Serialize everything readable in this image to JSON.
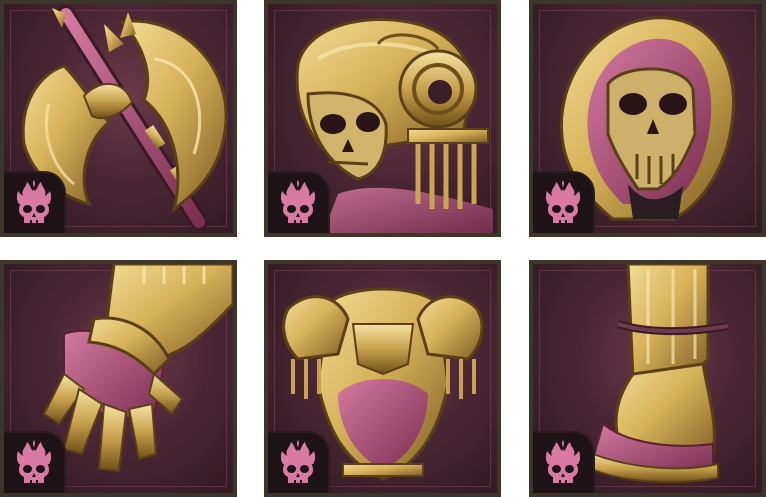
{
  "inventory": {
    "slots": [
      {
        "item": "axe-icon"
      },
      {
        "item": "ram-skull-helm-icon"
      },
      {
        "item": "skull-mask-icon"
      },
      {
        "item": "gauntlet-icon"
      },
      {
        "item": "chest-armor-icon"
      },
      {
        "item": "boot-icon"
      }
    ],
    "badge_icon": "flaming-skull-icon"
  },
  "colors": {
    "gold": "#d7b25a",
    "gold_dark": "#8a6a2a",
    "gold_light": "#f2dc95",
    "magenta": "#b8567e",
    "frame": "#3b352a",
    "tile_bg": "#4a2634",
    "badge_bg": "#1e1418",
    "badge_icon": "#d97aa3"
  }
}
